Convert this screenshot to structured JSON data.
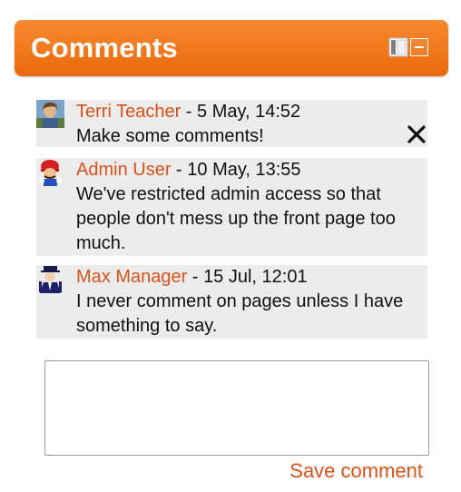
{
  "block": {
    "title": "Comments",
    "dock_icon": "dock-icon",
    "collapse_icon": "collapse-icon"
  },
  "comments": [
    {
      "author": "Terri Teacher",
      "separator": " - ",
      "date": "5 May, 14:52",
      "text": "Make some comments!",
      "avatar_icon": "teacher-avatar",
      "deletable": true
    },
    {
      "author": "Admin User",
      "separator": " - ",
      "date": "10 May, 13:55",
      "text": "We've restricted admin access so that people don't mess up the front page too much.",
      "avatar_icon": "admin-avatar",
      "deletable": false
    },
    {
      "author": "Max Manager",
      "separator": " - ",
      "date": "15 Jul, 12:01",
      "text": "I never comment on pages unless I have something to say.",
      "avatar_icon": "manager-avatar",
      "deletable": false
    }
  ],
  "form": {
    "comment_value": "",
    "save_label": "Save comment"
  },
  "colors": {
    "header_orange": "#ef7518",
    "author_link": "#d8511a",
    "comment_bg": "#ececec"
  }
}
